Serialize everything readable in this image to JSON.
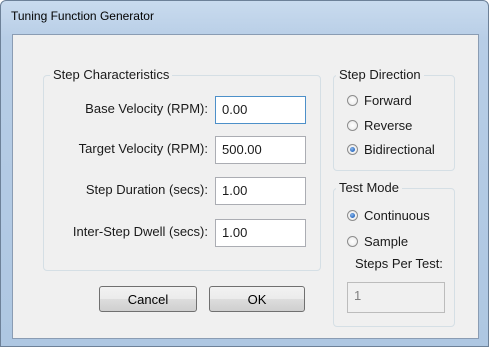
{
  "window": {
    "title": "Tuning Function Generator"
  },
  "step_characteristics": {
    "legend": "Step Characteristics",
    "fields": [
      {
        "label": "Base Velocity (RPM):",
        "value": "0.00"
      },
      {
        "label": "Target Velocity (RPM):",
        "value": "500.00"
      },
      {
        "label": "Step Duration (secs):",
        "value": "1.00"
      },
      {
        "label": "Inter-Step Dwell (secs):",
        "value": "1.00"
      }
    ]
  },
  "step_direction": {
    "legend": "Step Direction",
    "options": [
      "Forward",
      "Reverse",
      "Bidirectional"
    ],
    "selected": "Bidirectional"
  },
  "test_mode": {
    "legend": "Test Mode",
    "options": [
      "Continuous",
      "Sample"
    ],
    "selected": "Continuous",
    "steps_label": "Steps Per Test:",
    "steps_value": "1"
  },
  "buttons": {
    "cancel": "Cancel",
    "ok": "OK"
  }
}
